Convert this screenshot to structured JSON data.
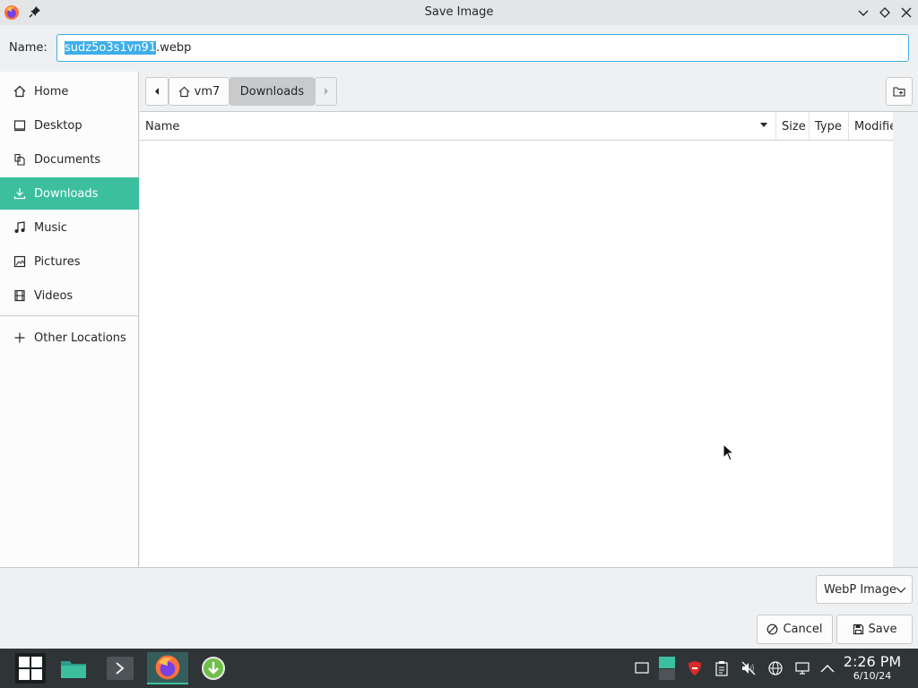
{
  "window": {
    "title": "Save Image",
    "app_icon": "firefox-icon",
    "controls": [
      "minimize-icon",
      "maximize-icon",
      "close-icon"
    ]
  },
  "name_field": {
    "label": "Name:",
    "value_selected": "sudz5o3s1vn91",
    "value_rest": ".webp"
  },
  "sidebar": {
    "items": [
      {
        "label": "Home",
        "icon": "home-icon"
      },
      {
        "label": "Desktop",
        "icon": "desktop-icon"
      },
      {
        "label": "Documents",
        "icon": "documents-icon"
      },
      {
        "label": "Downloads",
        "icon": "download-icon",
        "active": true
      },
      {
        "label": "Music",
        "icon": "music-icon"
      },
      {
        "label": "Pictures",
        "icon": "pictures-icon"
      },
      {
        "label": "Videos",
        "icon": "videos-icon"
      }
    ],
    "other_locations": "Other Locations"
  },
  "pathbar": {
    "crumbs": [
      "vm7",
      "Downloads"
    ],
    "active": "Downloads"
  },
  "filelist": {
    "columns": [
      "Name",
      "Size",
      "Type",
      "Modifie"
    ],
    "rows": []
  },
  "bottom": {
    "filetype": "WebP Image",
    "cancel_label": "Cancel",
    "save_label": "Save"
  },
  "taskbar": {
    "time": "2:26 PM",
    "date": "6/10/24"
  },
  "colors": {
    "accent": "#3bbf9f",
    "focus": "#3daee9"
  }
}
